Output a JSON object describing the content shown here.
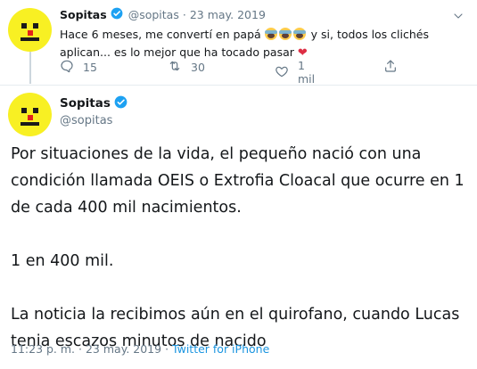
{
  "tweet_reply": {
    "author_name": "Sopitas",
    "handle": "@sopitas",
    "separator": "·",
    "date": "23 may. 2019",
    "text_part1": "Hace 6 meses, me convertí en papá ",
    "text_part2": " y si, todos los clichés aplican... es lo mejor que ha tocado pasar ",
    "emoji_icons": [
      "screaming-face-emoji",
      "screaming-face-emoji",
      "screaming-face-emoji",
      "red-heart-emoji"
    ],
    "reply_count": "15",
    "retweet_count": "30",
    "like_count": "1 mil"
  },
  "tweet_main": {
    "author_name": "Sopitas",
    "handle": "@sopitas",
    "text": "Por situaciones de la vida, el pequeño nació con una condición llamada OEIS o Extrofia Cloacal que ocurre en 1 de cada 400 mil nacimientos.\n\n1 en 400 mil.\n\nLa noticia la recibimos aún en el quirofano, cuando Lucas tenia escazos minutos de nacido",
    "time": "11:23 p. m.",
    "separator": "·",
    "date": "23 may. 2019",
    "source": "Twitter for iPhone"
  },
  "colors": {
    "accent": "#1da1f2",
    "link": "#1b95e0",
    "muted": "#657786",
    "text": "#14171a",
    "avatar_yellow": "#f8f023",
    "avatar_red": "#e3231b",
    "heart_red": "#dd2e44"
  }
}
